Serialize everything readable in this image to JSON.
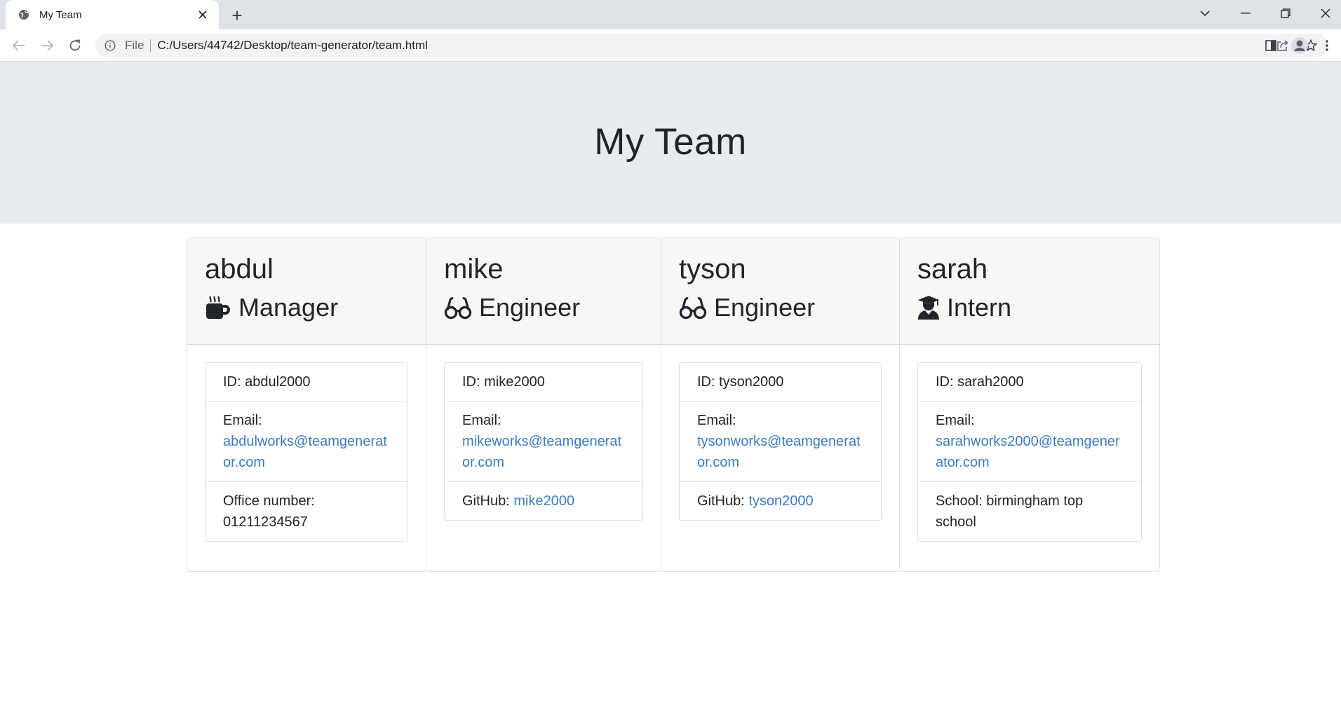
{
  "browser": {
    "tab_title": "My Team",
    "new_tab_symbol": "+",
    "address_scheme": "File",
    "url": "C:/Users/44742/Desktop/team-generator/team.html"
  },
  "page": {
    "title": "My Team"
  },
  "team": [
    {
      "name": "abdul",
      "role": "Manager",
      "role_icon": "mug-icon",
      "id_text": "ID: abdul2000",
      "email_label": "Email:",
      "email": "abdulworks@teamgenerator.com",
      "extra_label": "Office number:",
      "extra_value": "01211234567"
    },
    {
      "name": "mike",
      "role": "Engineer",
      "role_icon": "glasses-icon",
      "id_text": "ID: mike2000",
      "email_label": "Email:",
      "email": "mikeworks@teamgenerator.com",
      "extra_label": "GitHub:",
      "extra_value": "mike2000"
    },
    {
      "name": "tyson",
      "role": "Engineer",
      "role_icon": "glasses-icon",
      "id_text": "ID: tyson2000",
      "email_label": "Email:",
      "email": "tysonworks@teamgenerator.com",
      "extra_label": "GitHub:",
      "extra_value": "tyson2000"
    },
    {
      "name": "sarah",
      "role": "Intern",
      "role_icon": "graduate-icon",
      "id_text": "ID: sarah2000",
      "email_label": "Email:",
      "email": "sarahworks2000@teamgenerator.com",
      "extra_label": "School:",
      "extra_value": "birmingham top school"
    }
  ],
  "colors": {
    "jumbotron_bg": "#e9ecef",
    "card_header_bg": "#f7f7f7",
    "link": "#3a7cc6",
    "text": "#212529"
  }
}
